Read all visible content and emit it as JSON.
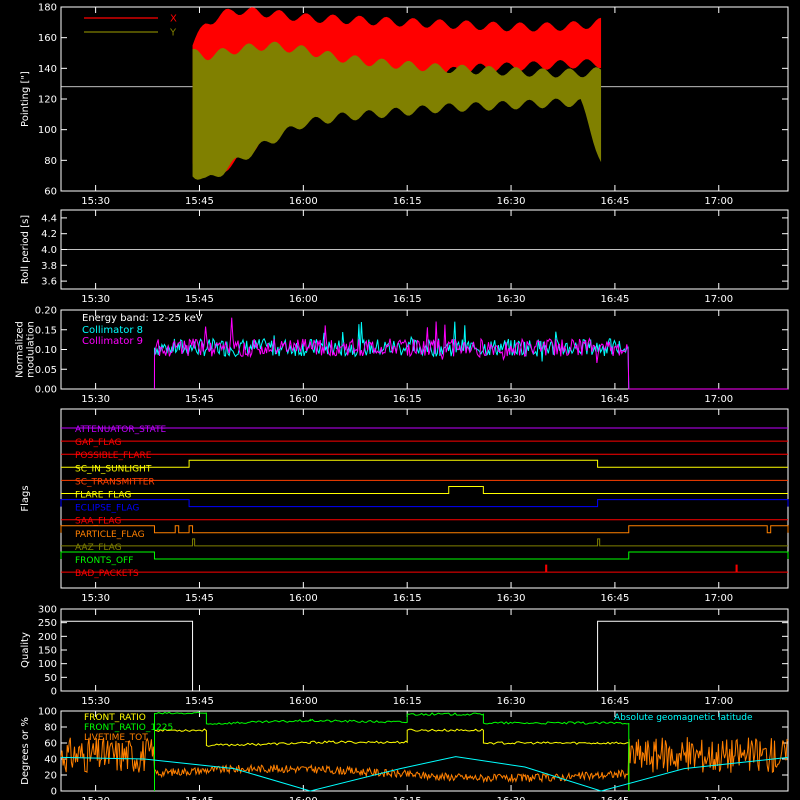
{
  "time_axis": {
    "tick_labels": [
      "15:30",
      "15:45",
      "16:00",
      "16:15",
      "16:30",
      "16:45",
      "17:00"
    ],
    "tick_minutes": [
      930,
      945,
      960,
      975,
      990,
      1005,
      1020
    ],
    "range_minutes": [
      925,
      1030
    ]
  },
  "colors": {
    "background": "#000000",
    "axis": "#ffffff",
    "red": "#ff0000",
    "olive": "#808000",
    "cyan": "#00ffff",
    "magenta": "#ff00ff",
    "yellow": "#ffff00",
    "green": "#00ff00",
    "orange": "#ff8000",
    "blue": "#0000ff",
    "purple": "#c000ff"
  },
  "chart_data": [
    {
      "type": "area",
      "ylabel": "Pointing [\"]",
      "ylim": [
        60,
        180
      ],
      "yticks": [
        60,
        80,
        100,
        120,
        140,
        160,
        180
      ],
      "reference_line": 128,
      "series": [
        {
          "name": "X",
          "color": "#ff0000",
          "x": [
            944,
            946,
            950,
            955,
            960,
            965,
            970,
            975,
            980,
            985,
            990,
            995,
            1000,
            1003
          ],
          "upper": [
            155,
            170,
            178,
            176,
            173,
            172,
            171,
            170,
            169,
            168,
            167,
            167,
            168,
            170
          ],
          "lower": [
            78,
            70,
            78,
            96,
            112,
            122,
            128,
            133,
            137,
            140,
            141,
            142,
            143,
            143
          ]
        },
        {
          "name": "Y",
          "color": "#808000",
          "x": [
            944,
            946,
            950,
            955,
            960,
            965,
            970,
            975,
            980,
            985,
            990,
            995,
            1000,
            1003
          ],
          "upper": [
            150,
            148,
            152,
            155,
            152,
            147,
            144,
            142,
            140,
            139,
            138,
            137,
            137,
            138
          ],
          "lower": [
            72,
            66,
            78,
            92,
            104,
            108,
            110,
            112,
            114,
            115,
            116,
            117,
            118,
            80
          ]
        }
      ]
    },
    {
      "type": "line",
      "ylabel": "Roll period [s]",
      "ylim": [
        3.5,
        4.5
      ],
      "yticks": [
        3.6,
        3.8,
        4.0,
        4.2,
        4.4
      ],
      "yticks_display": [
        "3.6",
        "3.8",
        "4.0",
        "4.2",
        "4.4"
      ],
      "series": [
        {
          "name": "",
          "color": "#ffffff",
          "x": [
            925,
            1030
          ],
          "values": [
            4.0,
            4.0
          ]
        }
      ]
    },
    {
      "type": "line",
      "ylabel": [
        "Normalized",
        "modulation"
      ],
      "ylim": [
        0,
        0.2
      ],
      "yticks": [
        0,
        0.05,
        0.1,
        0.15,
        0.2
      ],
      "yticks_display": [
        "0.00",
        "0.05",
        "0.10",
        "0.15",
        "0.20"
      ],
      "annotation": "Energy band: 12-25 keV",
      "active_range": [
        938.5,
        1007
      ],
      "series": [
        {
          "name": "Collimator 8",
          "color": "#00ffff",
          "mean": 0.105
        },
        {
          "name": "Collimator 9",
          "color": "#ff00ff",
          "mean": 0.105
        }
      ]
    },
    {
      "type": "line",
      "ylabel": "Flags",
      "flags": [
        {
          "name": "ATTENUATOR_STATE",
          "color": "#c000ff",
          "high": []
        },
        {
          "name": "GAP_FLAG",
          "color": "#ff0000",
          "high": []
        },
        {
          "name": "POSSIBLE_FLARE",
          "color": "#ff0000",
          "high": []
        },
        {
          "name": "SC_IN_SUNLIGHT",
          "color": "#ffff00",
          "high": [
            [
              943.5,
              1002.5
            ]
          ]
        },
        {
          "name": "SC_TRANSMITTER",
          "color": "#ff4000",
          "high": []
        },
        {
          "name": "FLARE_FLAG",
          "color": "#ffff00",
          "high": [
            [
              981,
              986
            ]
          ]
        },
        {
          "name": "ECLIPSE_FLAG",
          "color": "#0000ff",
          "high": [
            [
              925,
              943.5
            ],
            [
              1002.5,
              1030
            ]
          ]
        },
        {
          "name": "SAA_FLAG",
          "color": "#ff0000",
          "high": []
        },
        {
          "name": "PARTICLE_FLAG",
          "color": "#ff8000",
          "high": [
            [
              925,
              938.5
            ],
            [
              941.5,
              942
            ],
            [
              943.5,
              944
            ],
            [
              1007,
              1027
            ],
            [
              1027.5,
              1030
            ]
          ]
        },
        {
          "name": "AAZ_FLAG",
          "color": "#808000",
          "high": [
            [
              944,
              944.3
            ],
            [
              1002.5,
              1002.8
            ]
          ]
        },
        {
          "name": "FRONTS_OFF",
          "color": "#00ff00",
          "high": [
            [
              925,
              938.5
            ],
            [
              1007,
              1030
            ]
          ]
        },
        {
          "name": "BAD_PACKETS",
          "color": "#ff0000",
          "high": [
            [
              995,
              995.15
            ],
            [
              1022.5,
              1022.65
            ]
          ]
        }
      ]
    },
    {
      "type": "line",
      "ylabel": "Quality",
      "ylim": [
        0,
        300
      ],
      "yticks": [
        0,
        50,
        100,
        150,
        200,
        250,
        300
      ],
      "series": [
        {
          "name": "",
          "color": "#ffffff",
          "x": [
            925,
            944,
            944,
            1002.5,
            1002.5,
            1030
          ],
          "values": [
            255,
            255,
            0,
            0,
            255,
            255
          ]
        }
      ]
    },
    {
      "type": "line",
      "ylabel": "Degrees or %",
      "ylim": [
        0,
        100
      ],
      "yticks": [
        0,
        20,
        40,
        60,
        80,
        100
      ],
      "legend": [
        {
          "name": "FRONT_RATIO",
          "color": "#ffff00"
        },
        {
          "name": "FRONT_RATIO_1225",
          "color": "#00ff00"
        },
        {
          "name": "LIVETIME_TOT",
          "color": "#ff8000"
        }
      ],
      "annotation": "Absolute geomagnetic latitude",
      "annotation_color": "#00ffff",
      "series": [
        {
          "name": "FRONT_RATIO",
          "color": "#ffff00",
          "x": [
            938.5,
            938.5,
            946,
            946,
            961,
            961,
            975,
            975,
            986,
            986,
            1002.5,
            1002.5,
            1007,
            1007
          ],
          "values": [
            0,
            76,
            76,
            57,
            60,
            61,
            61,
            76,
            76,
            60,
            60,
            60,
            60,
            0
          ]
        },
        {
          "name": "FRONT_RATIO_1225",
          "color": "#00ff00",
          "x": [
            938.5,
            938.5,
            946,
            946,
            961,
            961,
            975,
            975,
            986,
            986,
            1007,
            1007
          ],
          "values": [
            0,
            97,
            97,
            84,
            88,
            88,
            86,
            96,
            96,
            85,
            85,
            0
          ]
        },
        {
          "name": "Absolute geomagnetic latitude",
          "color": "#00ffff",
          "x": [
            925,
            937,
            950,
            961,
            974,
            982,
            992,
            1003,
            1015,
            1030
          ],
          "values": [
            42,
            40,
            28,
            0,
            28,
            43,
            30,
            0,
            28,
            42
          ]
        }
      ]
    }
  ]
}
